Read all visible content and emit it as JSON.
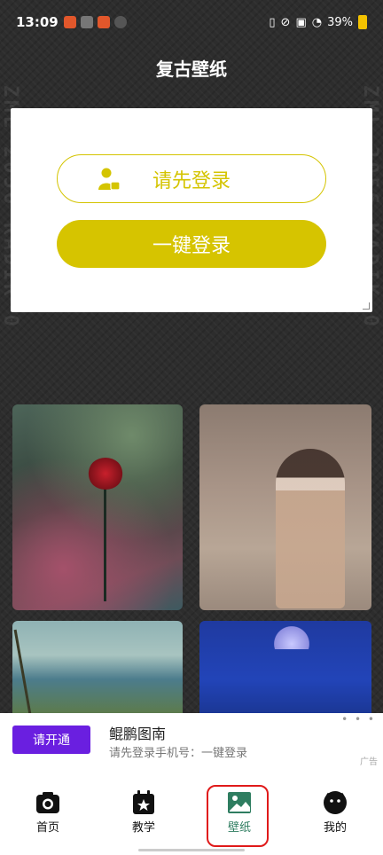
{
  "status_bar": {
    "time": "13:09",
    "battery": "39%"
  },
  "header": {
    "title": "复古壁纸"
  },
  "login_card": {
    "prompt_label": "请先登录",
    "one_click_label": "一键登录"
  },
  "wallpapers": [
    {
      "name": "red-rose-vintage-newspaper"
    },
    {
      "name": "woman-in-coat-sepia"
    },
    {
      "name": "coastal-village-palm"
    },
    {
      "name": "blue-blossoms-moon"
    }
  ],
  "ad": {
    "button_label": "请开通",
    "title": "鲲鹏图南",
    "subtitle": "请先登录手机号：一键登录",
    "tag": "广告",
    "close": "• • •"
  },
  "nav": {
    "items": [
      {
        "label": "首页",
        "icon": "camera-icon"
      },
      {
        "label": "教学",
        "icon": "calendar-star-icon"
      },
      {
        "label": "壁纸",
        "icon": "image-icon"
      },
      {
        "label": "我的",
        "icon": "face-icon"
      }
    ],
    "active_color": "#2e7d60"
  },
  "colors": {
    "accent": "#d6c400",
    "ad_button": "#6a1fe0",
    "highlight": "#e01a1a"
  }
}
